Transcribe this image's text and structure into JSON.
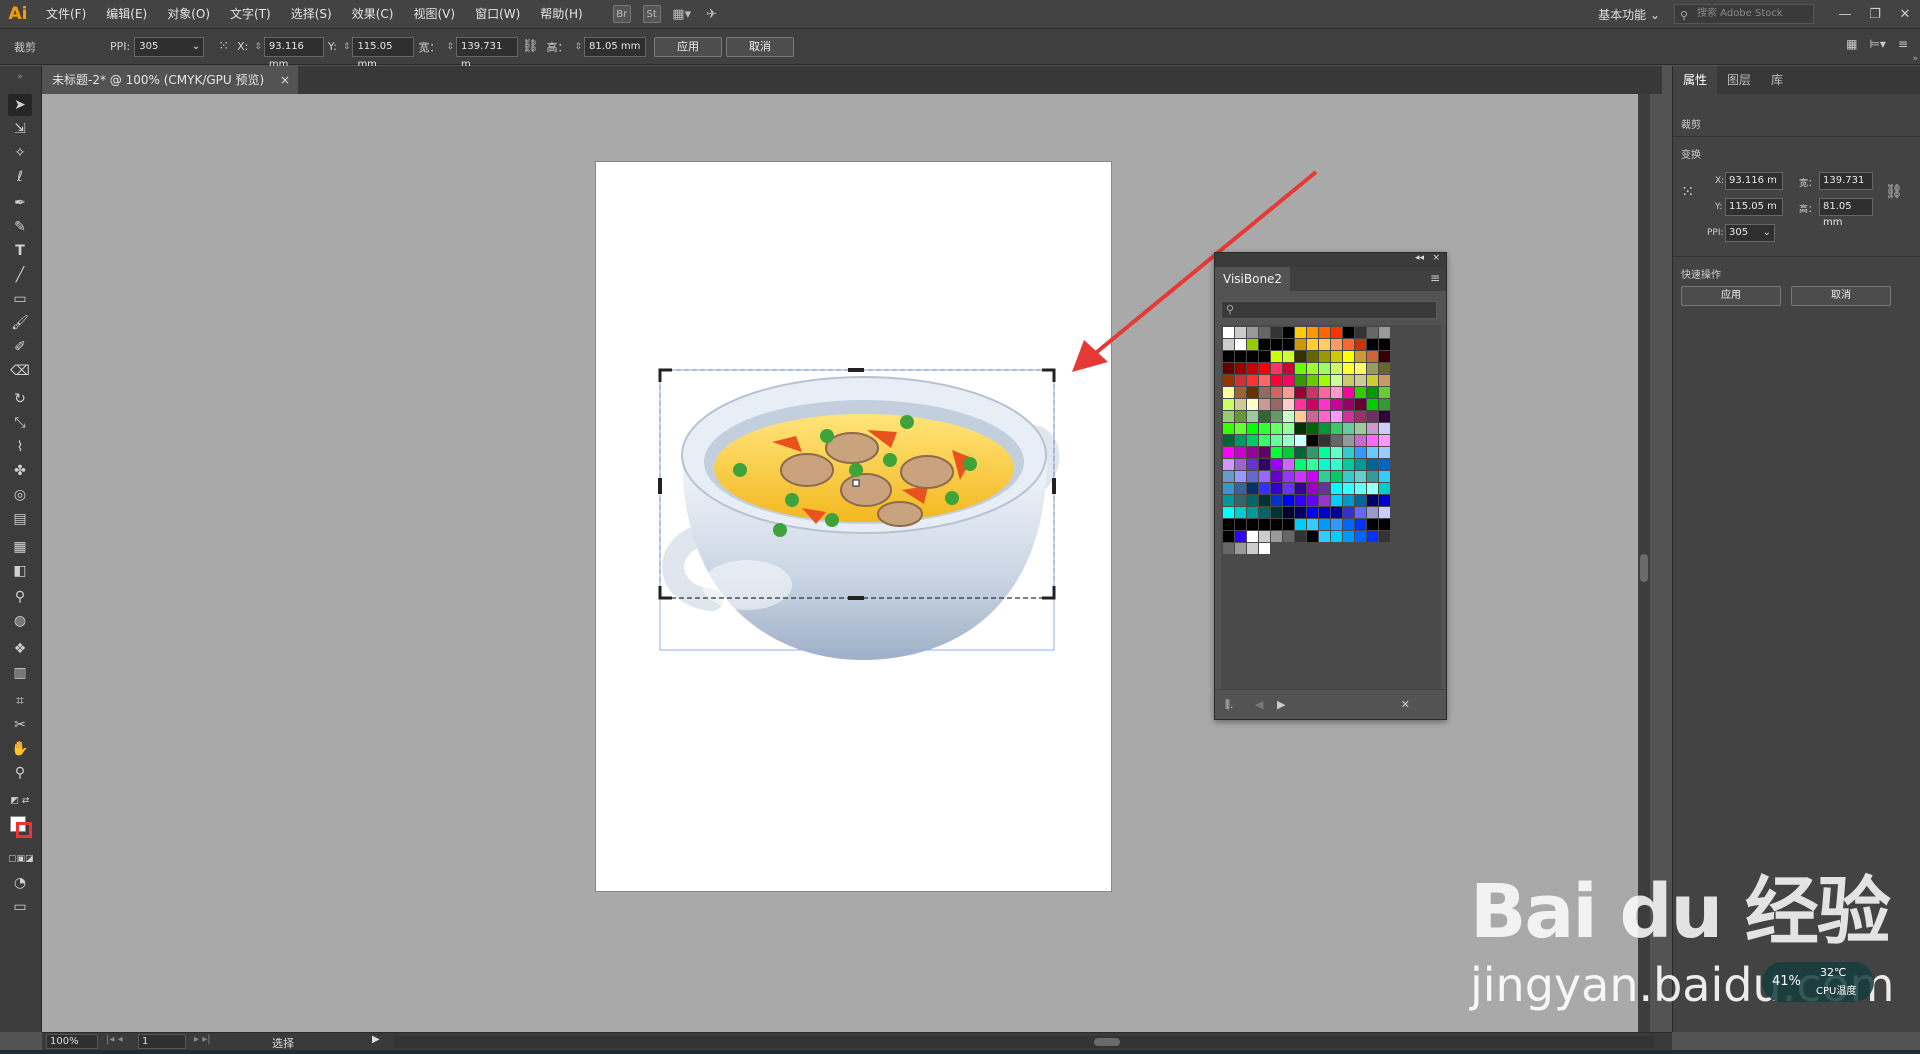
{
  "app": {
    "logo": "Ai"
  },
  "menu": [
    "文件(F)",
    "编辑(E)",
    "对象(O)",
    "文字(T)",
    "选择(S)",
    "效果(C)",
    "视图(V)",
    "窗口(W)",
    "帮助(H)"
  ],
  "menubar_icons": {
    "br": "Br",
    "st": "St"
  },
  "workspace": "基本功能",
  "stock_search_placeholder": "搜索 Adobe Stock",
  "controlbar": {
    "mode_label": "裁剪",
    "ppi_label": "PPI:",
    "ppi_value": "305",
    "x_label": "X:",
    "x_value": "93.116 mm",
    "y_label": "Y:",
    "y_value": "115.05 mm",
    "w_label": "宽：",
    "w_value": "139.731 m",
    "h_label": "高：",
    "h_value": "81.05 mm",
    "apply": "应用",
    "cancel": "取消"
  },
  "document_tab": "未标题-2* @ 100% (CMYK/GPU 预览)",
  "document_tab_close": "×",
  "properties": {
    "tabs": [
      "属性",
      "图层",
      "库"
    ],
    "section_crop": "裁剪",
    "section_transform": "变换",
    "x_label": "X:",
    "x_value": "93.116 m",
    "y_label": "Y:",
    "y_value": "115.05 m",
    "w_label": "宽：",
    "w_value": "139.731",
    "h_label": "高：",
    "h_value": "81.05 mm",
    "ppi_label": "PPI:",
    "ppi_value": "305",
    "section_quick": "快速操作",
    "apply": "应用",
    "cancel": "取消"
  },
  "swatch_panel": {
    "title": "VisiBone2",
    "collapse": "◂◂",
    "close": "×",
    "menu": "≡",
    "search_icon": "⚲"
  },
  "statusbar": {
    "zoom": "100%",
    "page": "1",
    "tool": "选择"
  },
  "watermark": {
    "brand": "Bai du 经验",
    "site": "jingyan.baidu.com"
  },
  "cpu_widget": {
    "temp": "32℃",
    "label": "CPU温度",
    "pct": "41%"
  },
  "colors": {
    "accent": "#ff9a00",
    "arrow": "#e53935",
    "artboard": "#ffffff",
    "pasteboard": "#a9a9a9"
  },
  "swatch_colors": [
    "#FFFFFF",
    "#CCCCCC",
    "#999999",
    "#666666",
    "#333333",
    "#000000",
    "#FFCC00",
    "#FF9900",
    "#FF6600",
    "#FF3300",
    "#000000",
    "#333333",
    "#666666",
    "#999999",
    "#CCCCCC",
    "#FFFFFF",
    "#99CC00",
    "#000000",
    "#000000",
    "#000000",
    "#CC9900",
    "#FFCC33",
    "#FFCC66",
    "#FF9966",
    "#FF6633",
    "#CC3300",
    "#000000",
    "#000000",
    "#000000",
    "#000000",
    "#000000",
    "#000000",
    "#CCFF00",
    "#CCFF33",
    "#333300",
    "#666600",
    "#999900",
    "#CCCC00",
    "#FFFF00",
    "#CC9933",
    "#CC6633",
    "#330000",
    "#660000",
    "#990000",
    "#CC0000",
    "#FF0000",
    "#FF3366",
    "#CC0033",
    "#66FF00",
    "#99FF33",
    "#99FF66",
    "#CCFF66",
    "#FFFF33",
    "#FFFF66",
    "#999966",
    "#666633",
    "#993300",
    "#CC3333",
    "#FF3333",
    "#FF6666",
    "#FF0033",
    "#FF0066",
    "#339900",
    "#66CC00",
    "#99FF00",
    "#CCFF99",
    "#CCCC66",
    "#CCCC99",
    "#CCCC33",
    "#CC9966",
    "#FFFF99",
    "#996633",
    "#663300",
    "#996666",
    "#CC6666",
    "#FF9999",
    "#990033",
    "#CC3366",
    "#FF6699",
    "#FF99CC",
    "#FF0099",
    "#33CC00",
    "#009900",
    "#66CC33",
    "#CCFF66",
    "#CCCC99",
    "#FFFFCC",
    "#CC9999",
    "#996666",
    "#FFCCCC",
    "#FF3399",
    "#CC0066",
    "#FF33CC",
    "#CC0099",
    "#990066",
    "#660033",
    "#00CC00",
    "#339933",
    "#99CC66",
    "#669933",
    "#99CC99",
    "#336633",
    "#669966",
    "#CCFFCC",
    "#FFCC99",
    "#CC6699",
    "#FF66CC",
    "#FF99FF",
    "#CC3399",
    "#993366",
    "#663366",
    "#330033",
    "#33FF00",
    "#66FF33",
    "#00FF00",
    "#33FF33",
    "#66FF66",
    "#99FF99",
    "#003300",
    "#006600",
    "#009933",
    "#33CC66",
    "#66CC99",
    "#99CC99",
    "#CC99CC",
    "#CCCCFF",
    "#006633",
    "#009966",
    "#00CC66",
    "#33FF66",
    "#66FF99",
    "#99FFCC",
    "#CCFFFF",
    "#000000",
    "#333333",
    "#666666",
    "#999999",
    "#CC66CC",
    "#FF66FF",
    "#FF99FF",
    "#FF00FF",
    "#CC00CC",
    "#990099",
    "#660066",
    "#00FF33",
    "#00CC33",
    "#006633",
    "#339966",
    "#00FF99",
    "#66FFCC",
    "#33CCCC",
    "#3399FF",
    "#66CCFF",
    "#99CCFF",
    "#CC99FF",
    "#9966CC",
    "#6633CC",
    "#330066",
    "#9900FF",
    "#CC66FF",
    "#00FF66",
    "#33FF99",
    "#00FFCC",
    "#33FFCC",
    "#00CC99",
    "#009999",
    "#006699",
    "#0066CC",
    "#6699CC",
    "#9999FF",
    "#6666CC",
    "#9966FF",
    "#6600CC",
    "#9933FF",
    "#CC33FF",
    "#CC00FF",
    "#33CC99",
    "#00CC66",
    "#33CCCC",
    "#66CCCC",
    "#339999",
    "#33CCFF",
    "#3399CC",
    "#336699",
    "#003366",
    "#3333FF",
    "#3300CC",
    "#6633FF",
    "#330099",
    "#9900CC",
    "#663399",
    "#00FFFF",
    "#33FFFF",
    "#66FFFF",
    "#99FFFF",
    "#00CCCC",
    "#009999",
    "#336666",
    "#006666",
    "#003333",
    "#0033CC",
    "#0000FF",
    "#3300FF",
    "#6600FF",
    "#9933CC",
    "#00CCFF",
    "#0099CC",
    "#006699",
    "#000066",
    "#0000CC",
    "#00FFFF",
    "#00CCCC",
    "#009999",
    "#006666",
    "#003333",
    "#000033",
    "#000066",
    "#0000FF",
    "#0000CC",
    "#000099",
    "#3333CC",
    "#6666FF",
    "#9999CC",
    "#CCCCFF",
    "#000000",
    "#000000",
    "#000000",
    "#000000",
    "#000000",
    "#000000",
    "#00CCFF",
    "#33CCFF",
    "#0099FF",
    "#3399FF",
    "#0066FF",
    "#0033FF",
    "#000000",
    "#000000",
    "#000000",
    "#3300FF",
    "#FFFFFF",
    "#CCCCCC",
    "#999999",
    "#666666",
    "#333333",
    "#000000",
    "#33CCFF",
    "#00CCFF",
    "#0099FF",
    "#0066FF",
    "#0033FF",
    "#333333",
    "#666666",
    "#999999",
    "#CCCCCC",
    "#FFFFFF"
  ]
}
